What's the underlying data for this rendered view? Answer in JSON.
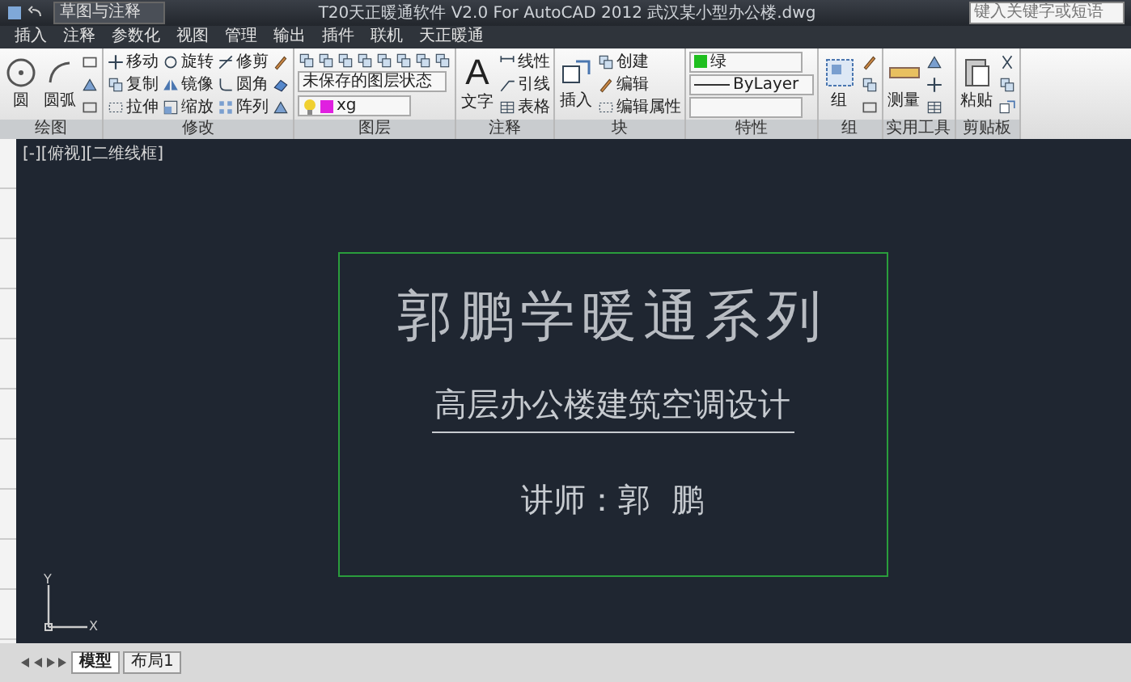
{
  "title_bar": {
    "workspace": "草图与注释",
    "title": "T20天正暖通软件 V2.0 For AutoCAD 2012  武汉某小型办公楼.dwg",
    "search_placeholder": "键入关键字或短语"
  },
  "menu_tabs": [
    {
      "label": "插入",
      "selected": false
    },
    {
      "label": "注释",
      "selected": false
    },
    {
      "label": "参数化",
      "selected": false
    },
    {
      "label": "视图",
      "selected": false
    },
    {
      "label": "管理",
      "selected": false
    },
    {
      "label": "输出",
      "selected": false
    },
    {
      "label": "插件",
      "selected": false
    },
    {
      "label": "联机",
      "selected": false
    },
    {
      "label": "天正暖通",
      "selected": false
    }
  ],
  "ribbon_panels": [
    {
      "title": "绘图",
      "columns": [
        [
          {
            "kind": "large",
            "label": "圆"
          }
        ],
        [
          {
            "kind": "large",
            "label": "圆弧"
          }
        ],
        [
          {
            "kind": "icon"
          },
          {
            "kind": "icon"
          },
          {
            "kind": "icon"
          }
        ]
      ]
    },
    {
      "title": "修改",
      "columns": [
        [
          {
            "kind": "small",
            "label": "移动"
          },
          {
            "kind": "small",
            "label": "复制"
          },
          {
            "kind": "small",
            "label": "拉伸"
          }
        ],
        [
          {
            "kind": "small",
            "label": "旋转"
          },
          {
            "kind": "small",
            "label": "镜像"
          },
          {
            "kind": "small",
            "label": "缩放"
          }
        ],
        [
          {
            "kind": "small",
            "label": "修剪"
          },
          {
            "kind": "small",
            "label": "圆角"
          },
          {
            "kind": "small",
            "label": "阵列"
          }
        ],
        [
          {
            "kind": "icon"
          },
          {
            "kind": "icon"
          },
          {
            "kind": "icon"
          }
        ]
      ]
    },
    {
      "title": "图层",
      "columns": [
        [
          {
            "kind": "iconrow"
          },
          {
            "kind": "combo",
            "label": "未保存的图层状态"
          },
          {
            "kind": "layer",
            "label": "xg"
          }
        ]
      ]
    },
    {
      "title": "注释",
      "columns": [
        [
          {
            "kind": "glyph",
            "glyph": "A",
            "label": "文字"
          }
        ],
        [
          {
            "kind": "small",
            "label": "线性"
          },
          {
            "kind": "small",
            "label": "引线"
          },
          {
            "kind": "small",
            "label": "表格"
          }
        ]
      ]
    },
    {
      "title": "块",
      "columns": [
        [
          {
            "kind": "large",
            "label": "插入"
          }
        ],
        [
          {
            "kind": "small",
            "label": "创建"
          },
          {
            "kind": "small",
            "label": "编辑"
          },
          {
            "kind": "small",
            "label": "编辑属性"
          }
        ]
      ]
    },
    {
      "title": "特性",
      "columns": [
        [
          {
            "kind": "color",
            "label": "绿"
          },
          {
            "kind": "linetype",
            "label": "ByLayer"
          },
          {
            "kind": "combo"
          }
        ]
      ]
    },
    {
      "title": "组",
      "columns": [
        [
          {
            "kind": "large",
            "label": "组"
          }
        ],
        [
          {
            "kind": "icon"
          },
          {
            "kind": "icon"
          },
          {
            "kind": "icon"
          }
        ]
      ]
    },
    {
      "title": "实用工具",
      "columns": [
        [
          {
            "kind": "large",
            "label": "测量"
          }
        ],
        [
          {
            "kind": "icon"
          },
          {
            "kind": "icon"
          },
          {
            "kind": "icon"
          }
        ]
      ]
    },
    {
      "title": "剪贴板",
      "columns": [
        [
          {
            "kind": "large",
            "label": "粘贴"
          }
        ],
        [
          {
            "kind": "icon"
          },
          {
            "kind": "icon"
          },
          {
            "kind": "icon"
          }
        ]
      ]
    }
  ],
  "viewport": {
    "label": "[-][俯视][二维线框]",
    "drawing": {
      "title": "郭鹏学暖通系列",
      "subtitle": "高层办公楼建筑空调设计",
      "lecturer": "讲师：郭  鹏"
    },
    "ucs": {
      "x_label": "X",
      "y_label": "Y"
    }
  },
  "layout_tabs": [
    {
      "label": "模型",
      "selected": true
    },
    {
      "label": "布局1",
      "selected": false
    }
  ]
}
